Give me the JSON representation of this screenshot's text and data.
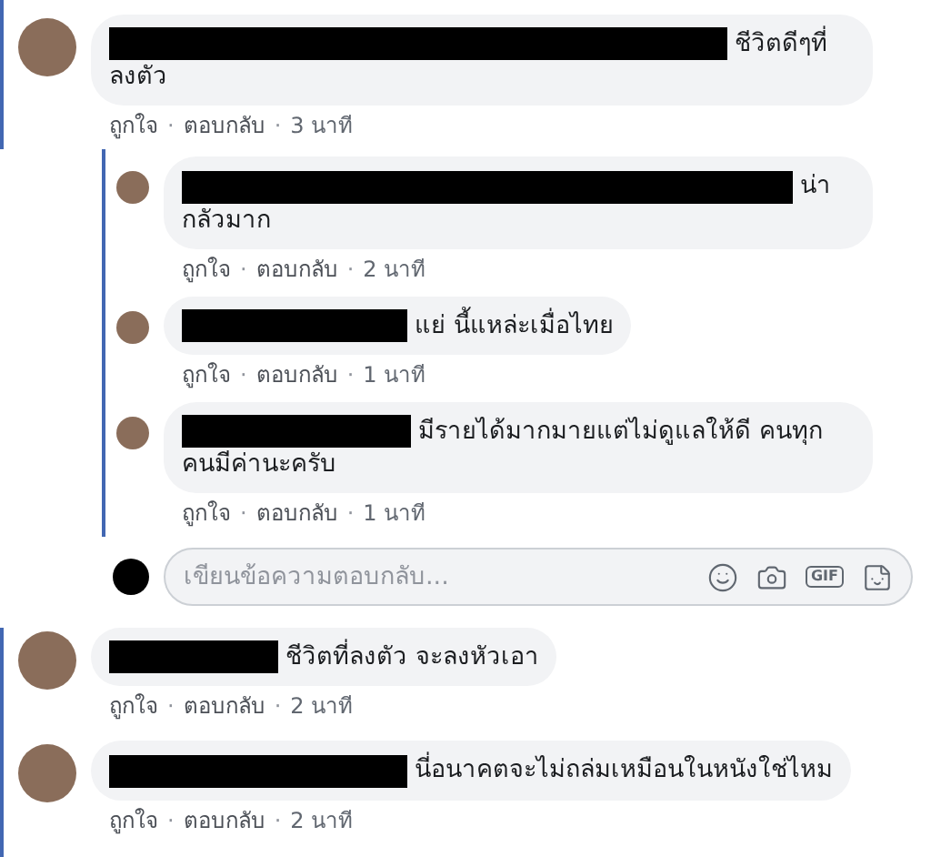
{
  "thread_top": [
    {
      "text": "ชีวิตดีๆที่ลงตัว",
      "actions": [
        {
          "kind": "link",
          "text": "ถูกใจ"
        },
        {
          "kind": "separator",
          "text": "·"
        },
        {
          "kind": "link",
          "text": "ตอบกลับ"
        },
        {
          "kind": "separator",
          "text": "·"
        },
        {
          "kind": "time",
          "text": "3 นาที"
        }
      ],
      "replies": [
        {
          "text": "น่ากลัวมาก",
          "actions": [
            {
              "kind": "link",
              "text": "ถูกใจ"
            },
            {
              "kind": "separator",
              "text": "·"
            },
            {
              "kind": "link",
              "text": "ตอบกลับ"
            },
            {
              "kind": "separator",
              "text": "·"
            },
            {
              "kind": "time",
              "text": "2 นาที"
            }
          ]
        },
        {
          "text": "แย่ นี้แหล่ะเมื่อไทย",
          "actions": [
            {
              "kind": "link",
              "text": "ถูกใจ"
            },
            {
              "kind": "separator",
              "text": "·"
            },
            {
              "kind": "link",
              "text": "ตอบกลับ"
            },
            {
              "kind": "separator",
              "text": "·"
            },
            {
              "kind": "time",
              "text": "1 นาที"
            }
          ]
        },
        {
          "text": "มีรายได้มากมายแต่ไม่ดูแลให้ดี คนทุกคนมีค่านะครับ",
          "actions": [
            {
              "kind": "link",
              "text": "ถูกใจ"
            },
            {
              "kind": "separator",
              "text": "·"
            },
            {
              "kind": "link",
              "text": "ตอบกลับ"
            },
            {
              "kind": "separator",
              "text": "·"
            },
            {
              "kind": "time",
              "text": "1 นาที"
            }
          ]
        }
      ],
      "reply_box": {
        "placeholder": "เขียนข้อความตอบกลับ...",
        "gif_label": "GIF"
      }
    }
  ],
  "comments": [
    {
      "text": "ชีวิตที่ลงตัว จะลงหัวเอา",
      "actions": [
        {
          "kind": "link",
          "text": "ถูกใจ"
        },
        {
          "kind": "separator",
          "text": "·"
        },
        {
          "kind": "link",
          "text": "ตอบกลับ"
        },
        {
          "kind": "separator",
          "text": "·"
        },
        {
          "kind": "time",
          "text": "2 นาที"
        }
      ]
    },
    {
      "text": "นี่อนาคตจะไม่ถล่มเหมือนในหนังใช่ไหม",
      "actions": [
        {
          "kind": "link",
          "text": "ถูกใจ"
        },
        {
          "kind": "separator",
          "text": "·"
        },
        {
          "kind": "link",
          "text": "ตอบกลับ"
        },
        {
          "kind": "separator",
          "text": "·"
        },
        {
          "kind": "time",
          "text": "2 นาที"
        }
      ]
    }
  ]
}
